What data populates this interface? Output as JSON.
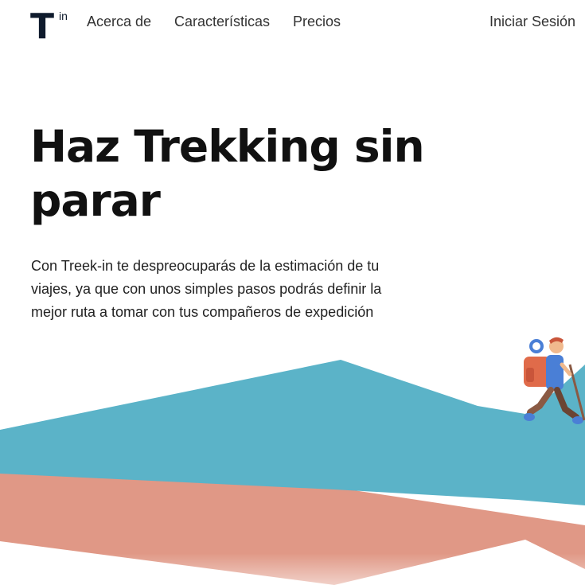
{
  "nav": {
    "logo": {
      "letter": "T",
      "superscript": "in"
    },
    "links": [
      {
        "label": "Acerca de"
      },
      {
        "label": "Características"
      },
      {
        "label": "Precios"
      }
    ],
    "login_label": "Iniciar Sesión"
  },
  "hero": {
    "title": "Haz Trekking sin parar",
    "description": "Con Treek-in te despreocuparás de la estimación de tu viajes, ya que con unos simples pasos podrás definir la mejor ruta a tomar con tus compañeros de expedición"
  },
  "illustration": {
    "icon": "hiker-icon",
    "colors": {
      "mountain_blue": "#5bb3c8",
      "mountain_salmon": "#e09886",
      "logo_dark": "#0f1b2d"
    }
  }
}
